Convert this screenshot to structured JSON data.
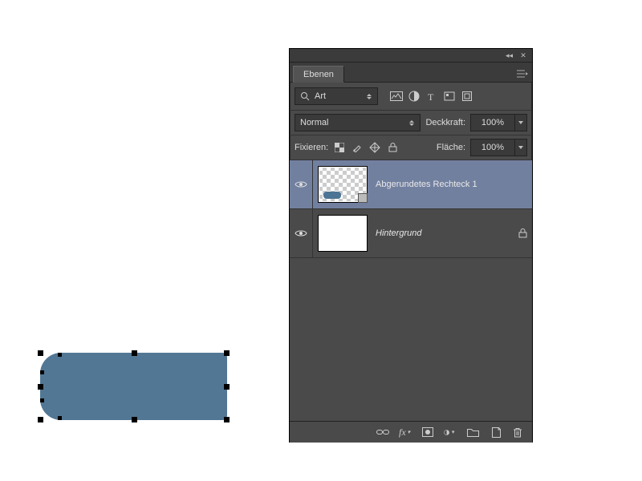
{
  "panel": {
    "title_tab": "Ebenen",
    "filter_label": "Art",
    "blend_mode": "Normal",
    "opacity_label": "Deckkraft:",
    "opacity_value": "100%",
    "fill_label": "Fläche:",
    "fill_value": "100%",
    "lock_label": "Fixieren:"
  },
  "layers": [
    {
      "name": "Abgerundetes Rechteck 1",
      "selected": true,
      "bg": false,
      "locked": false
    },
    {
      "name": "Hintergrund",
      "selected": false,
      "bg": true,
      "locked": true
    }
  ],
  "canvas": {
    "shape_color": "#527794"
  }
}
